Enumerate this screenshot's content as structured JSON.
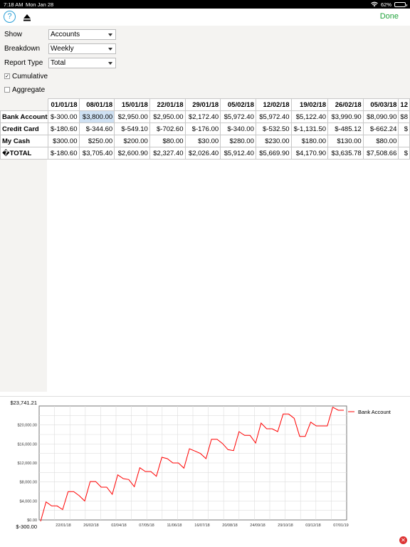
{
  "status": {
    "time": "7:18 AM",
    "date": "Mon Jan 28",
    "battery": "62%"
  },
  "toolbar": {
    "help_label": "?",
    "done_label": "Done"
  },
  "controls": {
    "show_label": "Show",
    "show_value": "Accounts",
    "breakdown_label": "Breakdown",
    "breakdown_value": "Weekly",
    "report_type_label": "Report Type",
    "report_type_value": "Total",
    "cumulative_label": "Cumulative",
    "cumulative_checked": true,
    "aggregate_label": "Aggregate",
    "aggregate_checked": false
  },
  "table": {
    "columns": [
      "01/01/18",
      "08/01/18",
      "15/01/18",
      "22/01/18",
      "29/01/18",
      "05/02/18",
      "12/02/18",
      "19/02/18",
      "26/02/18",
      "05/03/18",
      "12"
    ],
    "rows": [
      {
        "label": "Bank Account",
        "values": [
          "$-300.00",
          "$3,800.00",
          "$2,950.00",
          "$2,950.00",
          "$2,172.40",
          "$5,972.40",
          "$5,972.40",
          "$5,122.40",
          "$3,990.90",
          "$8,090.90",
          "$8"
        ]
      },
      {
        "label": "Credit Card",
        "values": [
          "$-180.60",
          "$-344.60",
          "$-549.10",
          "$-702.60",
          "$-176.00",
          "$-340.00",
          "$-532.50",
          "$-1,131.50",
          "$-485.12",
          "$-662.24",
          "$"
        ]
      },
      {
        "label": "My Cash",
        "values": [
          "$300.00",
          "$250.00",
          "$200.00",
          "$80.00",
          "$30.00",
          "$280.00",
          "$230.00",
          "$180.00",
          "$130.00",
          "$80.00",
          ""
        ]
      },
      {
        "label": "�TOTAL",
        "values": [
          "$-180.60",
          "$3,705.40",
          "$2,600.90",
          "$2,327.40",
          "$2,026.40",
          "$5,912.40",
          "$5,669.90",
          "$4,170.90",
          "$3,635.78",
          "$7,508.66",
          "$"
        ]
      }
    ]
  },
  "chart_data": {
    "type": "line",
    "max_label": "$23,741.21",
    "min_label": "$-300.00",
    "ylim": [
      0,
      24000
    ],
    "yticks": [
      "$0.00",
      "$4,000.00",
      "$8,000.00",
      "$12,000.00",
      "$16,000.00",
      "$20,000.00"
    ],
    "ytick_values": [
      0,
      4000,
      8000,
      12000,
      16000,
      20000
    ],
    "xticks": [
      "22/01/18",
      "26/02/18",
      "02/04/18",
      "07/05/18",
      "11/06/18",
      "16/07/18",
      "20/08/18",
      "24/09/18",
      "29/10/18",
      "03/12/18",
      "07/01/19"
    ],
    "series": [
      {
        "name": "Bank Account",
        "color": "#ff0000",
        "values": [
          -300,
          3800,
          2950,
          2950,
          2172,
          5972,
          5972,
          5122,
          3991,
          8091,
          8091,
          6900,
          6900,
          5400,
          9500,
          8700,
          8500,
          7000,
          11000,
          10200,
          10200,
          9200,
          13200,
          12900,
          12000,
          12000,
          10900,
          15000,
          14500,
          14000,
          12900,
          17000,
          17000,
          16100,
          14800,
          14600,
          18600,
          17800,
          17800,
          16200,
          20400,
          19200,
          19200,
          18600,
          22300,
          22300,
          21400,
          17600,
          17600,
          20600,
          19800,
          19800,
          19800,
          23741,
          23100,
          23100
        ]
      }
    ]
  }
}
